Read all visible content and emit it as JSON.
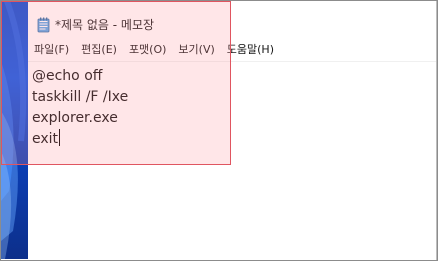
{
  "window": {
    "title": "*제목 없음 - 메모장",
    "icon": "notepad-icon"
  },
  "menu": {
    "items": [
      "파일(F)",
      "편집(E)",
      "포맷(O)",
      "보기(V)",
      "도움말(H)"
    ]
  },
  "editor": {
    "lines": [
      "@echo off",
      "taskkill /F /Ixe",
      "explorer.exe",
      "exit"
    ]
  },
  "colors": {
    "highlight_border": "#e05560",
    "highlight_fill": "#ffc8cd",
    "wallpaper": "#0b56e8"
  }
}
